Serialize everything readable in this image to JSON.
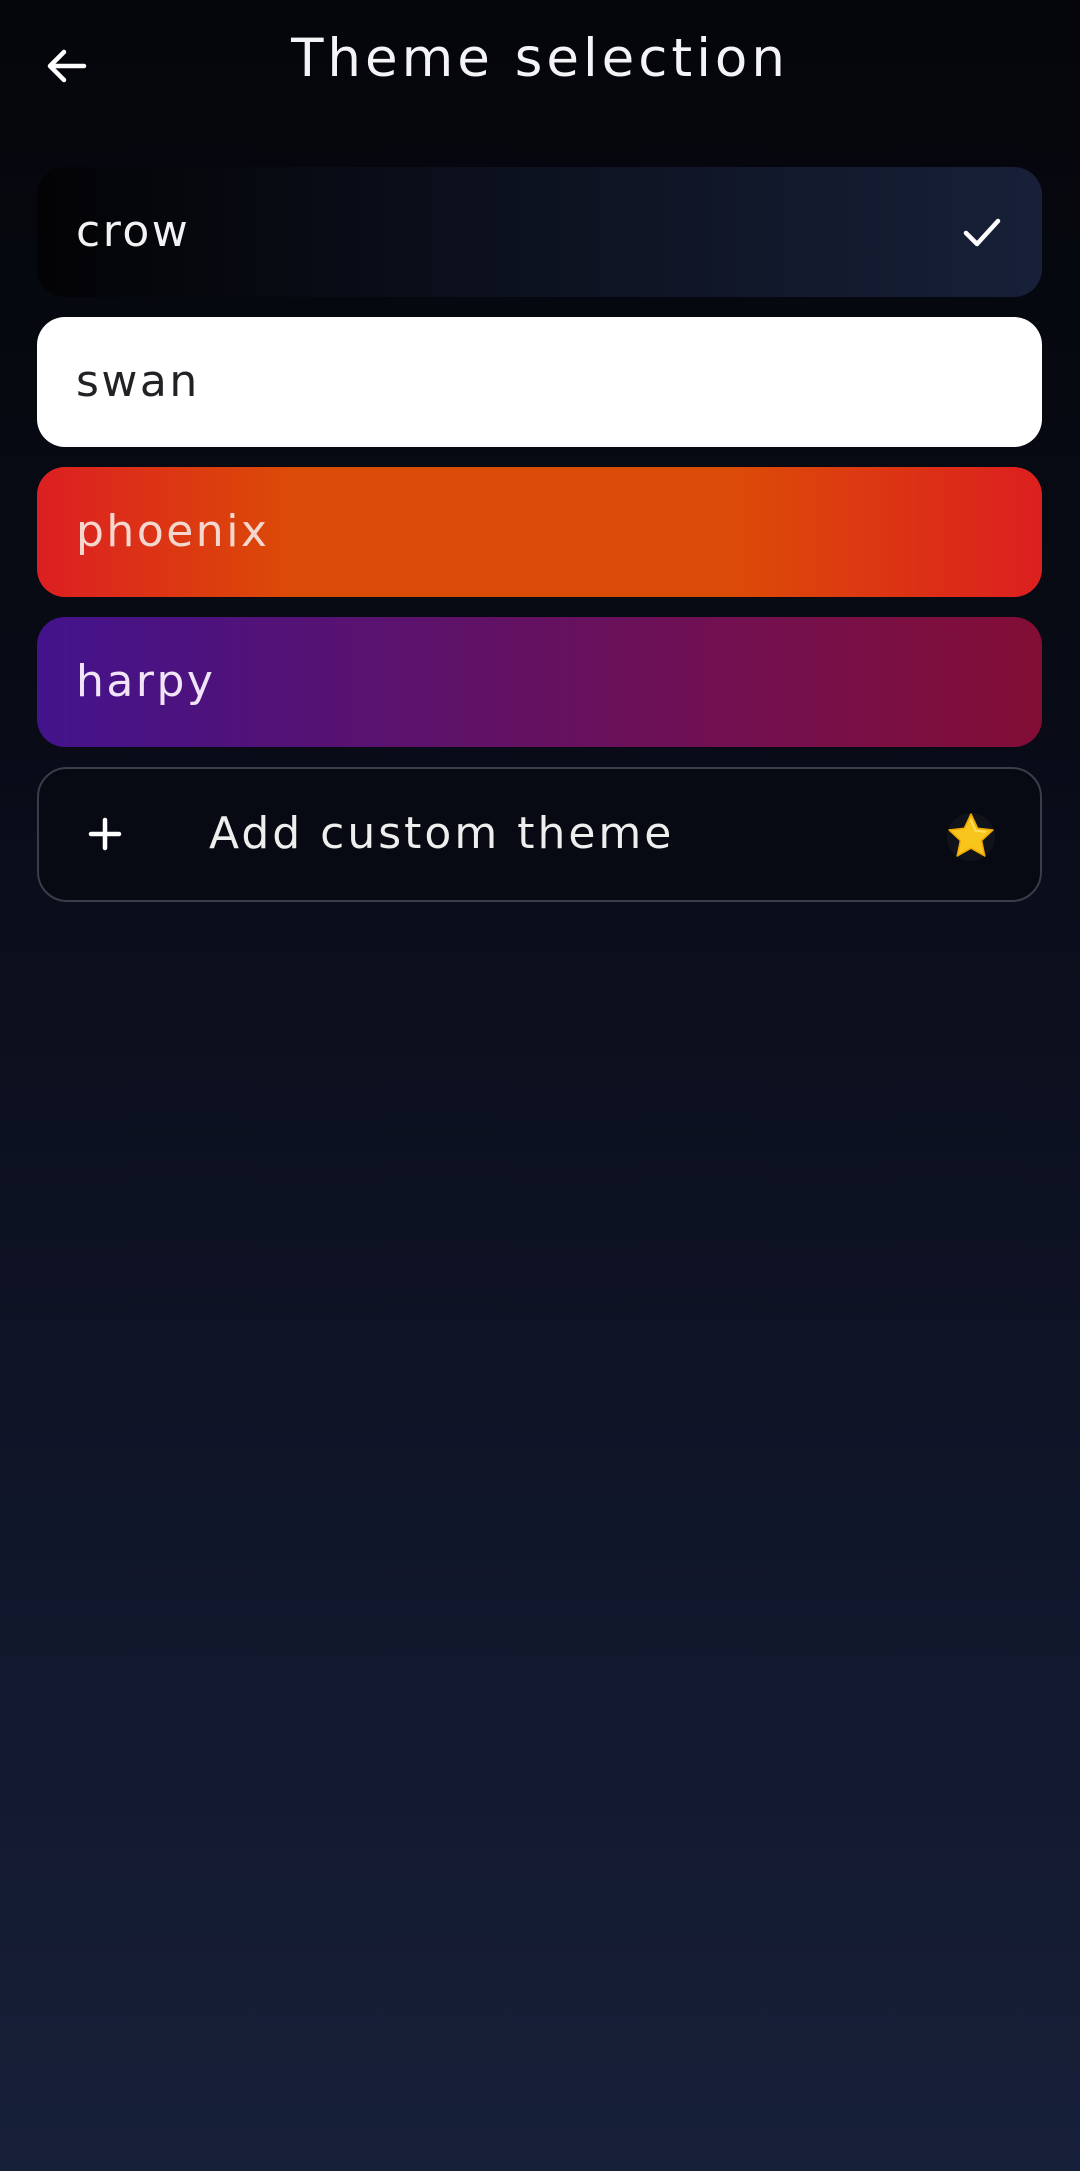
{
  "header": {
    "title": "Theme selection",
    "back_icon": "arrow-left-icon"
  },
  "themes": [
    {
      "id": "crow",
      "label": "crow",
      "selected": true,
      "colors": [
        "#030305",
        "#172038"
      ]
    },
    {
      "id": "swan",
      "label": "swan",
      "selected": false,
      "colors": [
        "#ffffff"
      ]
    },
    {
      "id": "phoenix",
      "label": "phoenix",
      "selected": false,
      "colors": [
        "#dc1f22",
        "#dc4a07"
      ]
    },
    {
      "id": "harpy",
      "label": "harpy",
      "selected": false,
      "colors": [
        "#43138c",
        "#820e35"
      ]
    }
  ],
  "add_custom": {
    "label": "Add custom theme",
    "icon": "plus-icon",
    "badge_icon": "star-icon",
    "badge_color": "#f8c51c"
  },
  "selected_icon": "check-icon"
}
